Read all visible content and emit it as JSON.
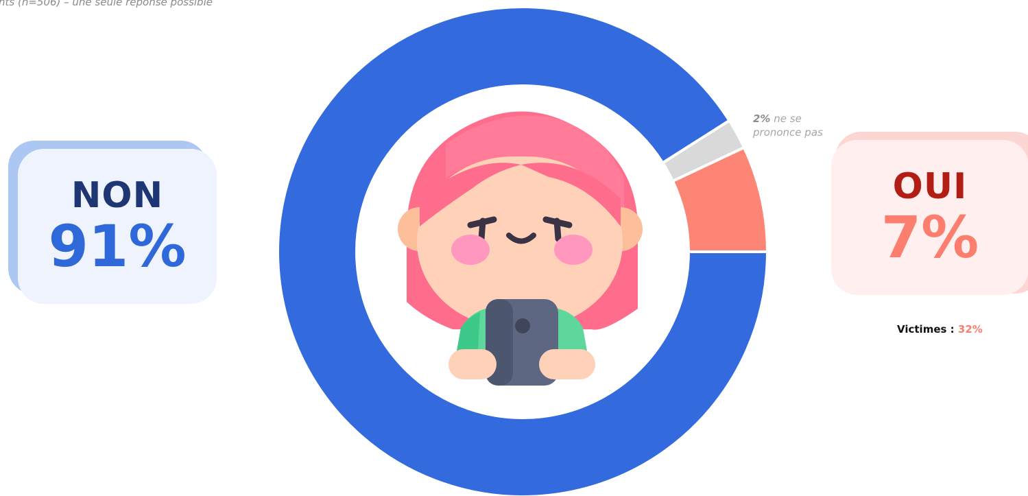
{
  "subtitle": "nts (n=506) – une seule réponse possible",
  "chart_data": {
    "type": "pie",
    "title": "",
    "categories": [
      "NON",
      "OUI",
      "ne se prononce pas"
    ],
    "values": [
      91,
      7,
      2
    ],
    "unit": "%",
    "colors": [
      "#336ade",
      "#fc8575",
      "#d9d9d9"
    ],
    "donut": true
  },
  "cards": {
    "non": {
      "label": "NON",
      "value": "91%"
    },
    "oui": {
      "label": "OUI",
      "value": "7%"
    }
  },
  "nsp": {
    "value": "2%",
    "text": "ne se prononce pas"
  },
  "victimes": {
    "label": "Victimes :",
    "value": "32%"
  },
  "center_icon": "angry-girl-with-phone-icon"
}
